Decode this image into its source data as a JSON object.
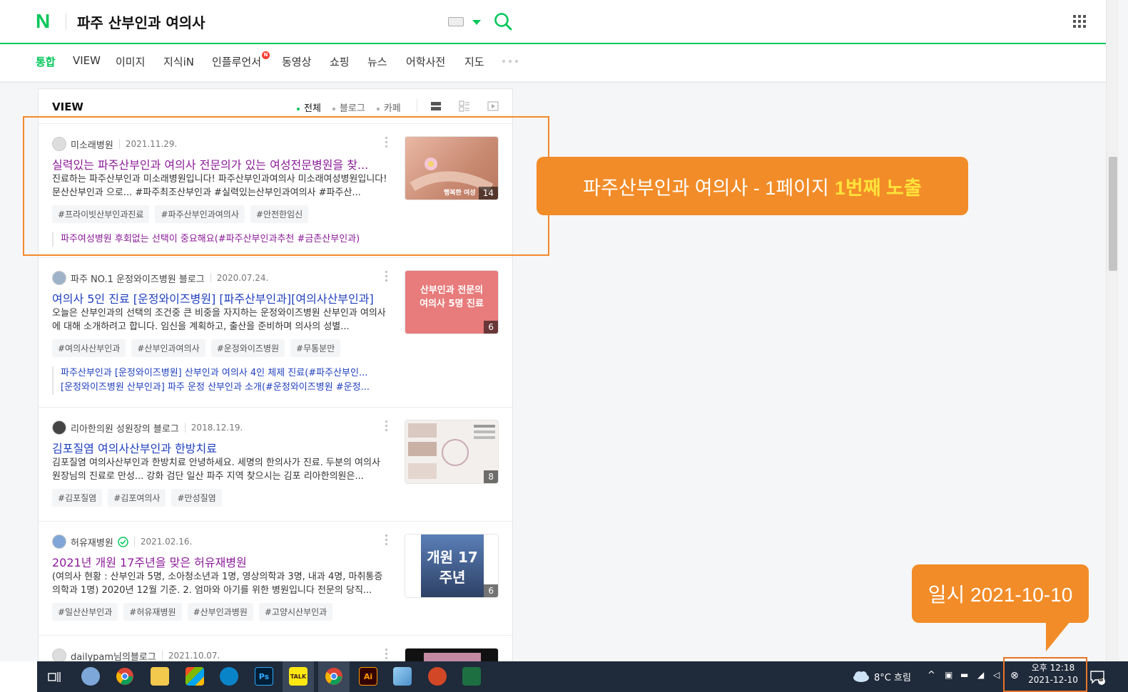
{
  "header": {
    "logo": "N",
    "query": "파주 산부인과 여의사"
  },
  "tabs": [
    {
      "label": "통합"
    },
    {
      "label": "VIEW"
    },
    {
      "label": "이미지"
    },
    {
      "label": "지식iN"
    },
    {
      "label": "인플루언서"
    },
    {
      "label": "동영상"
    },
    {
      "label": "쇼핑"
    },
    {
      "label": "뉴스"
    },
    {
      "label": "어학사전"
    },
    {
      "label": "지도"
    }
  ],
  "influencer_badge": "N",
  "view": {
    "title": "VIEW",
    "filters": [
      "전체",
      "블로그",
      "카페"
    ],
    "items": [
      {
        "author": "미소래병원",
        "date": "2021.11.29.",
        "title": "실력있는 파주산부인과 여의사 전문의가 있는 여성전문병원을 찾...",
        "desc": "진료하는 파주산부인과 미소래병원입니다! 파주산부인과여의사 미소래여성병원입니다! 문산산부인과 으로... #파주최조산부인과 #실력있는산부인과여의사 #파주산...",
        "tags": [
          "#프라이빗산부인과진료",
          "#파주산부인과여의사",
          "#안전한임신"
        ],
        "related": [
          "파주여성병원 후회없는 선택이 중요해요(#파주산부인과추천 #금촌산부인과)"
        ],
        "count": "14",
        "thumb_text": "행복한 여성"
      },
      {
        "author": "파주 NO.1 운정와이즈병원 블로그",
        "date": "2020.07.24.",
        "title": "여의사 5인 진료 [운정와이즈병원] [파주산부인과][여의사산부인과]",
        "desc": "오늘은 산부인과의 선택의 조건중 큰 비중을 자지하는 운정와이즈병원 산부인과 여의사에 대해 소개하려고 합니다. 임신을 계획하고, 출산을 준비하며 의사의 성별...",
        "tags": [
          "#여의사산부인과",
          "#산부인과여의사",
          "#운정와이즈병원",
          "#무통분만"
        ],
        "related": [
          "파주산부인과 [운정와이즈병원] 산부인과 여의사 4인 체제 진료(#파주산부인...",
          "[운정와이즈병원 산부인과] 파주 운정 산부인과 소개(#운정와이즈병원 #운정..."
        ],
        "count": "6",
        "thumb_text": "산부인과 전문의 여의사 5명 진료"
      },
      {
        "author": "리아한의원 성원장의 블로그",
        "date": "2018.12.19.",
        "title": "김포질염 여의사산부인과 한방치료",
        "desc": "김포질염 여의사산부인과 한방치료 안녕하세요. 세명의 한의사가 진료. 두분의 여의사 원장님의 진료로 만성... 강화 검단 일산 파주 지역 찾으시는 김포 리아한의원은...",
        "tags": [
          "#김포질염",
          "#김포여의사",
          "#만성질염"
        ],
        "count": "8"
      },
      {
        "author": "허유재병원",
        "date": "2021.02.16.",
        "title": "2021년 개원 17주년을 맞은 허유재병원",
        "desc": "(여의사 현황 : 산부인과 5명, 소아청소년과 1명, 영상의학과 3명, 내과 4명, 마취통증의학과 1명) 2020년 12월 기준.  2. 엄마와 아기를 위한 병원입니다 전문의 당직...",
        "tags": [
          "#일산산부인과",
          "#허유재병원",
          "#산부인과병원",
          "#고양시산부인과"
        ],
        "count": "6",
        "thumb_text": "개원 17주년"
      },
      {
        "author": "dailypam님의블로그",
        "date": "2021.10.07."
      }
    ]
  },
  "annotations": {
    "callout_main": "파주산부인과 여의사 - 1페이지",
    "callout_em": "1번째 노출",
    "date_label": "일시 2021-10-10"
  },
  "taskbar": {
    "weather": "8°C  흐림",
    "time": "오후 12:18",
    "date": "2021-12-10",
    "notif_count": "8",
    "talk": "TALK",
    "ps": "Ps",
    "ai": "Ai"
  },
  "colors": {
    "naver_green": "#03c75a",
    "visited": "#8b1b98",
    "link": "#1f3fbe",
    "annotation_orange": "#f28c28"
  }
}
